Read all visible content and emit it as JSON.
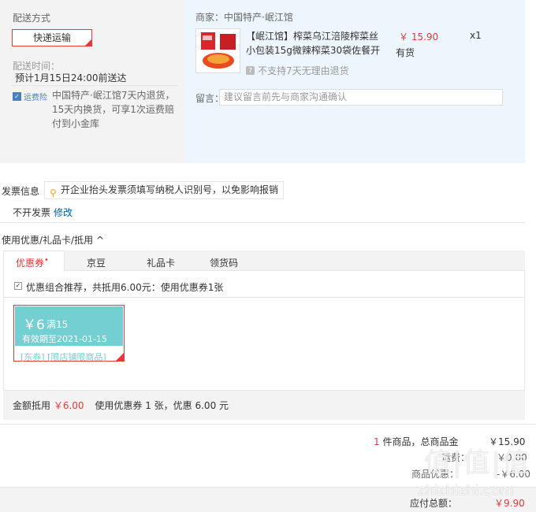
{
  "shipping": {
    "title": "配送方式",
    "method": "快递运输",
    "time_label": "配送时间：",
    "time_value": "预计1月15日24:00前送达",
    "insurance_badge": "运费险",
    "insurance_text": "中国特产·岷江馆7天内退货，15天内换货，可享1次运费赔付到小金库"
  },
  "merchant": {
    "label": "商家：中国特产·岷江馆",
    "product_title": "【岷江馆】榨菜乌江涪陵榨菜丝小包装15g微辣榨菜30袋佐餐开",
    "price": "￥ 15.90",
    "stock": "有货",
    "qty": "x1",
    "no_return": "不支持7天无理由退货",
    "message_label": "留言：",
    "message_placeholder": "建议留言前先与商家沟通确认"
  },
  "invoice": {
    "label": "发票信息",
    "tip": "开企业抬头发票须填写纳税人识别号，以免影响报销",
    "value": "不开发票",
    "edit": "修改"
  },
  "discounts": {
    "header": "使用优惠/礼品卡/抵用 ^",
    "tabs": [
      "优惠券",
      "京豆",
      "礼品卡",
      "领货码"
    ],
    "active_tab_marker": "•",
    "combo_text": "优惠组合推荐，共抵用6.00元：使用优惠券1张",
    "coupon": {
      "amount": "￥6",
      "condition": "满15",
      "valid": "有效期至2021-01-15",
      "tags": "[东券] [限店铺限商品]"
    },
    "amount_label": "金额抵用",
    "amount_value": "￥6.00",
    "amount_desc": "使用优惠券 1 张，优惠 6.00 元"
  },
  "summary": {
    "count": "1",
    "count_text": " 件商品，总商品金",
    "goods_total": "￥15.90",
    "shipping_label": "运费：",
    "shipping_value": "￥0.00",
    "discount_label": "商品优惠：",
    "discount_value": "-￥6.00",
    "total_label": "应付总额：",
    "total_value": "￥9.90"
  },
  "watermark": {
    "logo": "值|值|值",
    "url": "zhizhizhi.com"
  },
  "colors": {
    "accent_red": "#e4393c",
    "coupon_teal": "#74cfd2",
    "link_blue": "#005ea7",
    "panel_blue": "#eef6fd"
  }
}
